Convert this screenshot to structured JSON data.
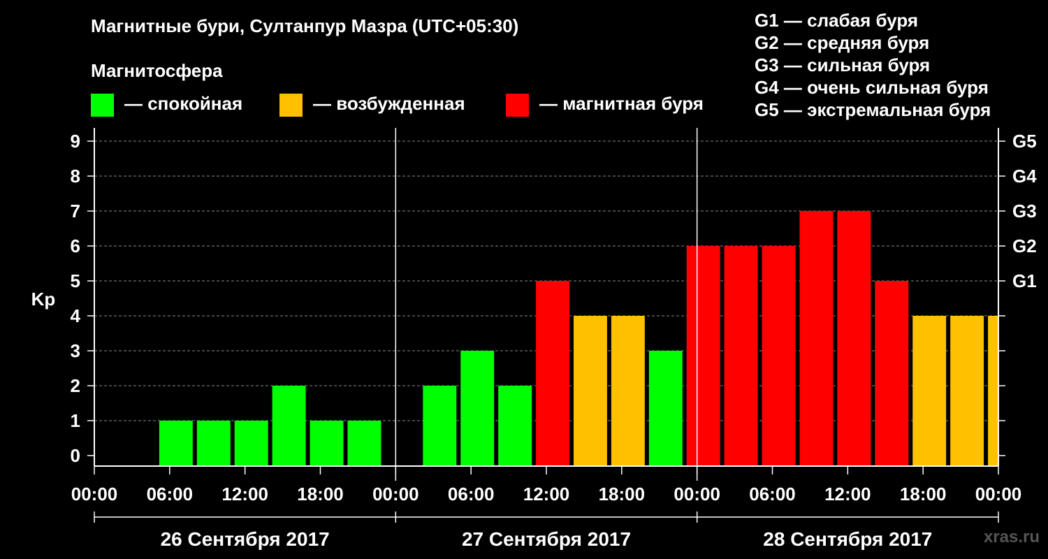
{
  "title": "Магнитные бури, Султанпур Мазра (UTC+05:30)",
  "legend": {
    "heading": "Магнитосфера",
    "items": [
      {
        "label": "— спокойная",
        "color": "#00ff00"
      },
      {
        "label": "— возбужденная",
        "color": "#ffc000"
      },
      {
        "label": "— магнитная буря",
        "color": "#ff0000"
      }
    ],
    "g_scale": [
      "G1 — слабая буря",
      "G2 — средняя буря",
      "G3 — сильная буря",
      "G4 — очень сильная буря",
      "G5 — экстремальная буря"
    ]
  },
  "watermark": "xras.ru",
  "chart_data": {
    "type": "bar",
    "ylabel": "Kp",
    "ylim": [
      0,
      9
    ],
    "yticks": [
      "0",
      "1",
      "2",
      "3",
      "4",
      "5",
      "6",
      "7",
      "8",
      "9"
    ],
    "right_ticks": [
      {
        "value": 5,
        "label": "G1"
      },
      {
        "value": 6,
        "label": "G2"
      },
      {
        "value": 7,
        "label": "G3"
      },
      {
        "value": 8,
        "label": "G4"
      },
      {
        "value": 9,
        "label": "G5"
      }
    ],
    "xtick_labels": [
      "00:00",
      "06:00",
      "12:00",
      "18:00",
      "00:00",
      "06:00",
      "12:00",
      "18:00",
      "00:00",
      "06:00",
      "12:00",
      "18:00",
      "00:00"
    ],
    "days": [
      "26 Сентября 2017",
      "27 Сентября 2017",
      "28 Сентября 2017"
    ],
    "grid": "dashed horizontal",
    "levels": [
      {
        "day": "26 Сентября 2017",
        "values": [
          0,
          1,
          1,
          1,
          2,
          1,
          1,
          0
        ]
      },
      {
        "day": "27 Сентября 2017",
        "values": [
          2,
          3,
          2,
          5,
          4,
          4,
          3,
          6
        ]
      },
      {
        "day": "28 Сентября 2017",
        "values": [
          6,
          6,
          7,
          7,
          5,
          4,
          4,
          4
        ]
      }
    ],
    "colors": {
      "quiet": "#00ff00",
      "active": "#ffc000",
      "storm": "#ff0000"
    }
  }
}
